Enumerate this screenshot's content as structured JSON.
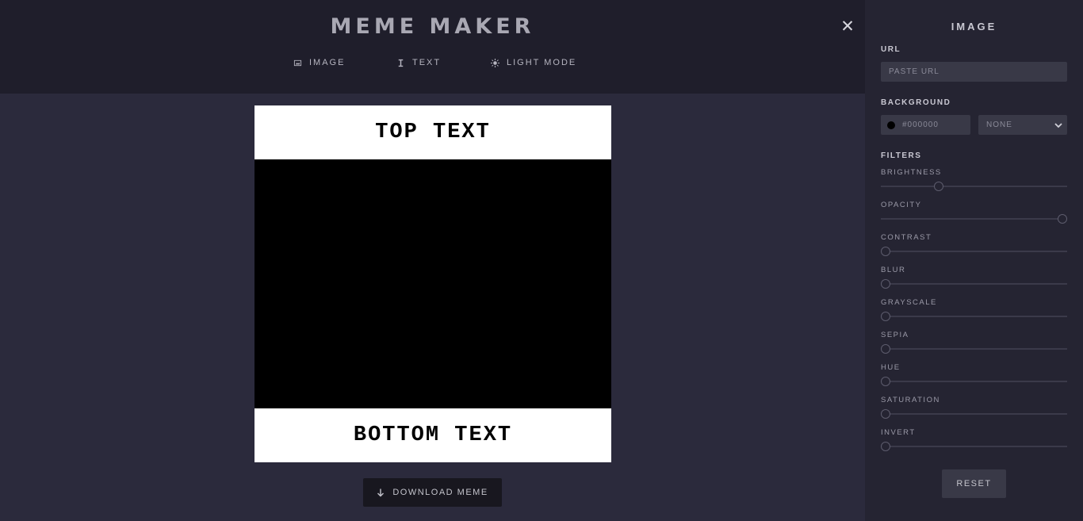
{
  "header": {
    "title": "MEME MAKER",
    "close_icon": "close-icon",
    "nav": [
      {
        "icon": "image-icon",
        "label": "IMAGE"
      },
      {
        "icon": "text-cursor-icon",
        "label": "TEXT"
      },
      {
        "icon": "sun-icon",
        "label": "LIGHT MODE"
      }
    ]
  },
  "meme": {
    "top_text": "TOP TEXT",
    "bottom_text": "BOTTOM TEXT",
    "image_color": "#000000",
    "caption_bg": "#ffffff"
  },
  "download": {
    "icon": "arrow-down-icon",
    "label": "DOWNLOAD MEME"
  },
  "sidebar": {
    "title": "IMAGE",
    "url_label": "URL",
    "url_placeholder": "PASTE URL",
    "background_label": "BACKGROUND",
    "background_color": "#000000",
    "background_option": "NONE",
    "filters_label": "FILTERS",
    "filters": [
      {
        "label": "BRIGHTNESS",
        "value": 0.3
      },
      {
        "label": "OPACITY",
        "value": 1.0
      },
      {
        "label": "CONTRAST",
        "value": 0
      },
      {
        "label": "BLUR",
        "value": 0
      },
      {
        "label": "GRAYSCALE",
        "value": 0
      },
      {
        "label": "SEPIA",
        "value": 0
      },
      {
        "label": "HUE",
        "value": 0
      },
      {
        "label": "SATURATION",
        "value": 0
      },
      {
        "label": "INVERT",
        "value": 0
      }
    ],
    "reset_label": "RESET"
  },
  "colors": {
    "page_bg": "#2b2a3c",
    "header_bg": "#1f1e2b",
    "sidebar_bg": "#252432",
    "field_bg": "#393947"
  }
}
